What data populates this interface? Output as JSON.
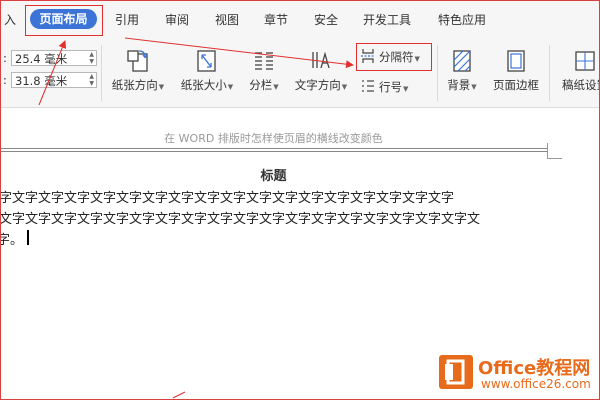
{
  "menu": {
    "items": [
      {
        "key": "insert-partial",
        "label": "入"
      },
      {
        "key": "page-layout",
        "label": "页面布局",
        "active": true
      },
      {
        "key": "references",
        "label": "引用"
      },
      {
        "key": "review",
        "label": "审阅"
      },
      {
        "key": "view",
        "label": "视图"
      },
      {
        "key": "section",
        "label": "章节"
      },
      {
        "key": "security",
        "label": "安全"
      },
      {
        "key": "developer",
        "label": "开发工具"
      },
      {
        "key": "special",
        "label": "特色应用"
      }
    ]
  },
  "ribbon": {
    "margin_top": {
      "prefix": ":",
      "value": "25.4 毫米"
    },
    "margin_bottom": {
      "prefix": ":",
      "value": "31.8 毫米"
    },
    "orientation": {
      "label": "纸张方向",
      "icon": "page-orientation-icon"
    },
    "size": {
      "label": "纸张大小",
      "icon": "page-size-icon"
    },
    "columns": {
      "label": "分栏",
      "icon": "columns-icon"
    },
    "text_direction": {
      "label": "文字方向",
      "icon": "text-direction-icon"
    },
    "breaks": {
      "label": "分隔符",
      "icon": "breaks-icon"
    },
    "line_numbers": {
      "label": "行号",
      "icon": "line-numbers-icon"
    },
    "background": {
      "label": "背景",
      "icon": "background-icon"
    },
    "page_border": {
      "label": "页面边框",
      "icon": "page-border-icon"
    },
    "paper_settings": {
      "label": "稿纸设置",
      "icon": "paper-grid-icon"
    }
  },
  "document": {
    "header_text": "在 WORD 排版时怎样使页眉的横线改变颜色",
    "title": "标题",
    "lines": [
      "   字文字文字文字文字文字文字文字文字文字文字文字文字文字文字文字文字文字",
      "文字文字文字文字文字文字文字文字文字文字文字文字文字文字文字文字文字文字文",
      "字。"
    ]
  },
  "watermark": {
    "line1": "Office教程网",
    "line2": "www.office26.com"
  },
  "colors": {
    "accent": "#3b74d6",
    "annotation_red": "#e0302e",
    "watermark_orange": "#e86b1c"
  }
}
